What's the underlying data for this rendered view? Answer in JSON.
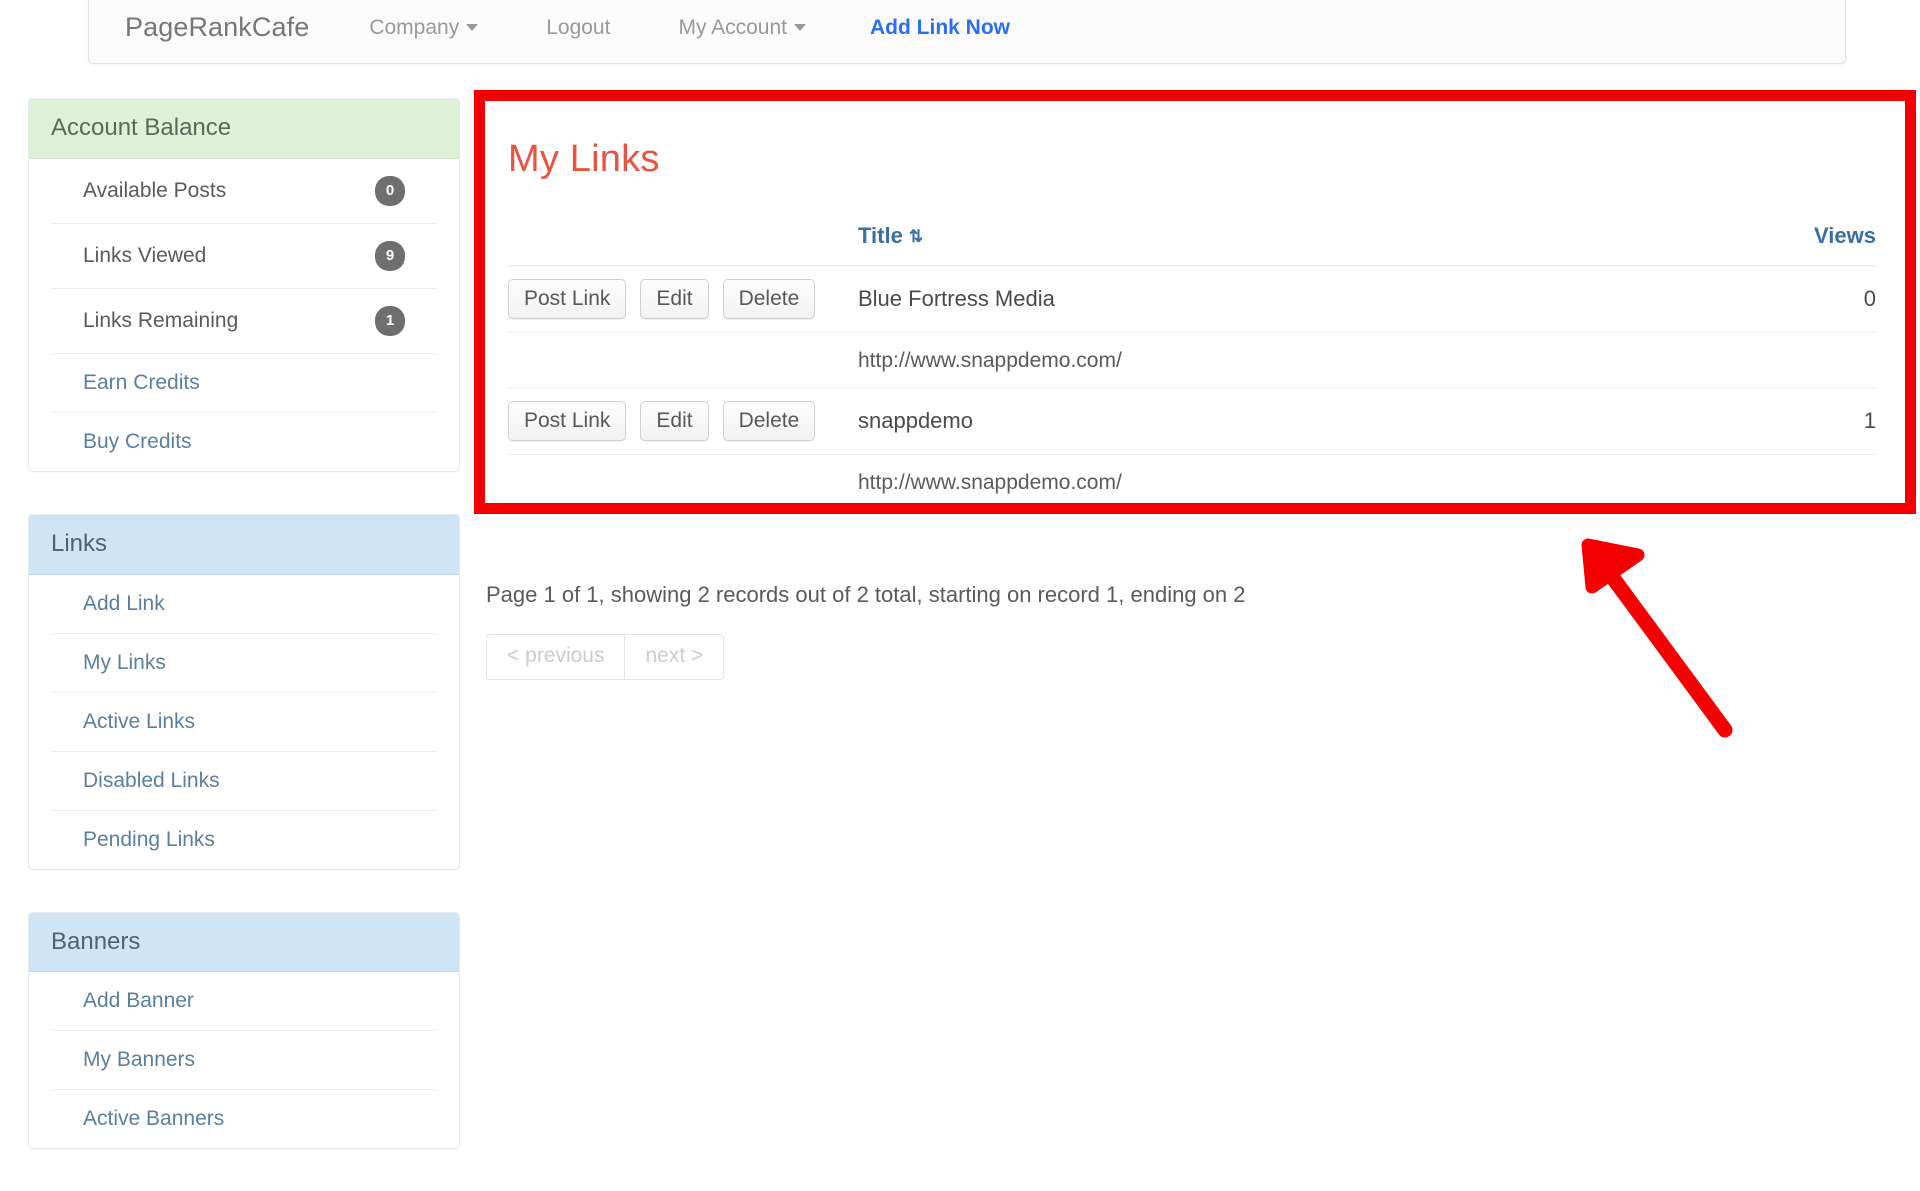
{
  "navbar": {
    "brand": "PageRankCafe",
    "items": [
      {
        "label": "Company",
        "caret": true
      },
      {
        "label": "Logout",
        "caret": false
      },
      {
        "label": "My Account",
        "caret": true
      }
    ],
    "cta": "Add Link Now"
  },
  "sidebar": {
    "panels": [
      {
        "title": "Account Balance",
        "style": "green",
        "rows": [
          {
            "label": "Available Posts",
            "badge": "0",
            "link": false
          },
          {
            "label": "Links Viewed",
            "badge": "9",
            "link": false
          },
          {
            "label": "Links Remaining",
            "badge": "1",
            "link": false
          },
          {
            "label": "Earn Credits",
            "badge": "",
            "link": true
          },
          {
            "label": "Buy Credits",
            "badge": "",
            "link": true
          }
        ]
      },
      {
        "title": "Links",
        "style": "blue",
        "rows": [
          {
            "label": "Add Link",
            "badge": "",
            "link": true
          },
          {
            "label": "My Links",
            "badge": "",
            "link": true
          },
          {
            "label": "Active Links",
            "badge": "",
            "link": true
          },
          {
            "label": "Disabled Links",
            "badge": "",
            "link": true
          },
          {
            "label": "Pending Links",
            "badge": "",
            "link": true
          }
        ]
      },
      {
        "title": "Banners",
        "style": "blue",
        "rows": [
          {
            "label": "Add Banner",
            "badge": "",
            "link": true
          },
          {
            "label": "My Banners",
            "badge": "",
            "link": true
          },
          {
            "label": "Active Banners",
            "badge": "",
            "link": true
          }
        ]
      }
    ]
  },
  "main": {
    "page_title": "My Links",
    "table": {
      "headers": {
        "actions": "",
        "title": "Title",
        "sort_icon": "⇅",
        "views": "Views"
      },
      "rows": [
        {
          "buttons": [
            "Post Link",
            "Edit",
            "Delete"
          ],
          "title": "Blue Fortress Media",
          "url": "http://www.snappdemo.com/",
          "views": "0"
        },
        {
          "buttons": [
            "Post Link",
            "Edit",
            "Delete"
          ],
          "title": "snappdemo",
          "url": "http://www.snappdemo.com/",
          "views": "1"
        }
      ]
    },
    "pager_info": "Page 1 of 1, showing 2 records out of 2 total, starting on record 1, ending on 2",
    "pager": {
      "previous": "< previous",
      "next": "next >"
    }
  },
  "annotation": {
    "box_color": "#f40000",
    "arrow_color": "#f40000"
  }
}
